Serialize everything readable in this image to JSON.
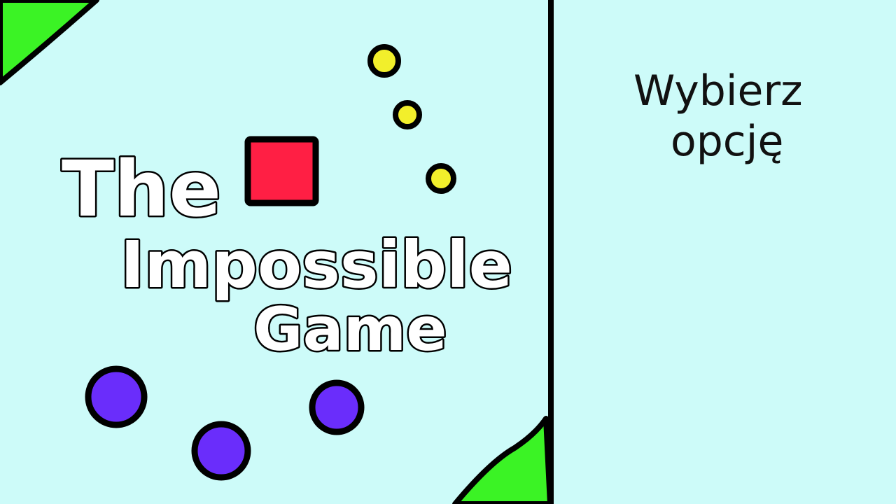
{
  "title": {
    "line1": "The",
    "line2": "Impossible",
    "line3": "Game"
  },
  "menu": {
    "heading_line1": "Wybierz",
    "heading_line2": "opcję"
  },
  "colors": {
    "background": "#cdfbf9",
    "grass": "#3bf325",
    "outline": "#000000",
    "player_square": "#ff1f44",
    "coin": "#f2ef2b",
    "orb": "#6a2dfb",
    "title_fill": "#ffffff"
  },
  "icons": {
    "player": "red-square-icon",
    "coins": "yellow-coin-icon",
    "orbs": "purple-orb-icon"
  }
}
